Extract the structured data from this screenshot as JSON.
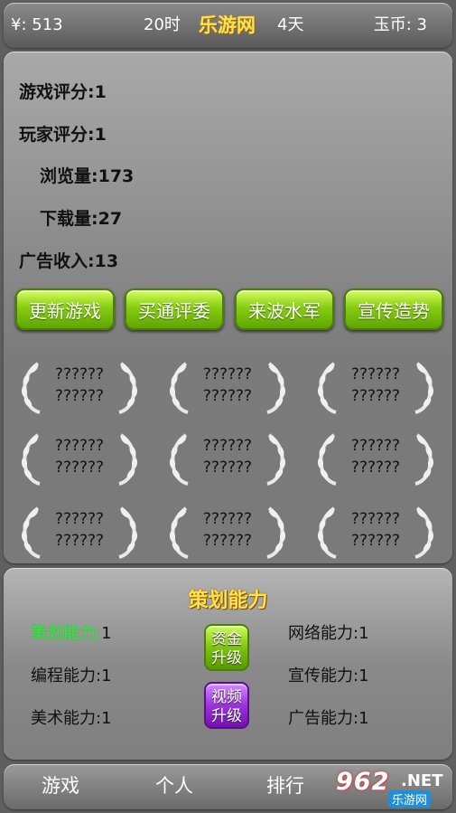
{
  "topbar": {
    "money": "¥: 513",
    "time": "20时",
    "title": "乐游网",
    "days": "4天",
    "coins": "玉币: 3"
  },
  "stats": [
    {
      "label": "游戏评分:",
      "value": "1"
    },
    {
      "label": "玩家评分:",
      "value": "1"
    },
    {
      "label": "浏览量:",
      "value": "173"
    },
    {
      "label": "下载量:",
      "value": "27"
    },
    {
      "label": "广告收入:",
      "value": "13"
    }
  ],
  "actions": [
    "更新游戏",
    "买通评委",
    "来波水军",
    "宣传造势"
  ],
  "awards": [
    {
      "line1": "??????",
      "line2": "??????"
    },
    {
      "line1": "??????",
      "line2": "??????"
    },
    {
      "line1": "??????",
      "line2": "??????"
    },
    {
      "line1": "??????",
      "line2": "??????"
    },
    {
      "line1": "??????",
      "line2": "??????"
    },
    {
      "line1": "??????",
      "line2": "??????"
    },
    {
      "line1": "??????",
      "line2": "??????"
    },
    {
      "line1": "??????",
      "line2": "??????"
    },
    {
      "line1": "??????",
      "line2": "??????"
    }
  ],
  "skills": {
    "title": "策划能力",
    "left": [
      {
        "label": "策划能力:",
        "value": "1"
      },
      {
        "label": "编程能力:",
        "value": "1"
      },
      {
        "label": "美术能力:",
        "value": "1"
      }
    ],
    "right": [
      {
        "label": "网络能力:",
        "value": "1"
      },
      {
        "label": "宣传能力:",
        "value": "1"
      },
      {
        "label": "广告能力:",
        "value": "1"
      }
    ],
    "fund_upgrade": [
      "资金",
      "升级"
    ],
    "video_upgrade": [
      "视频",
      "升级"
    ]
  },
  "nav": {
    "tabs": [
      "游戏",
      "个人",
      "排行"
    ]
  },
  "watermark": {
    "number": "962",
    "suffix": ".NET",
    "site": "乐游网"
  },
  "colors": {
    "accent_title": "#ffe24a",
    "button_green": "#7fc410",
    "button_purple": "#9a33dd",
    "active_skill": "#2ef02a"
  }
}
